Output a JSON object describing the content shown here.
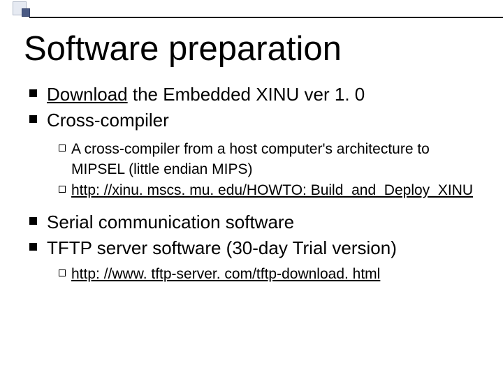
{
  "title": "Software preparation",
  "items": [
    {
      "pre": "",
      "link": "Download",
      "post": " the Embedded XINU ver 1. 0"
    },
    {
      "text": "Cross-compiler",
      "sub": [
        {
          "text": "A cross-compiler from a host computer's architecture to MIPSEL (little endian MIPS)"
        },
        {
          "link": "http: //xinu. mscs. mu. edu/HOWTO: Build_and_Deploy_XINU"
        }
      ]
    },
    {
      "text": "Serial communication software"
    },
    {
      "text": "TFTP server software (30-day Trial version)",
      "sub": [
        {
          "link": "http: //www. tftp-server. com/tftp-download. html"
        }
      ]
    }
  ]
}
